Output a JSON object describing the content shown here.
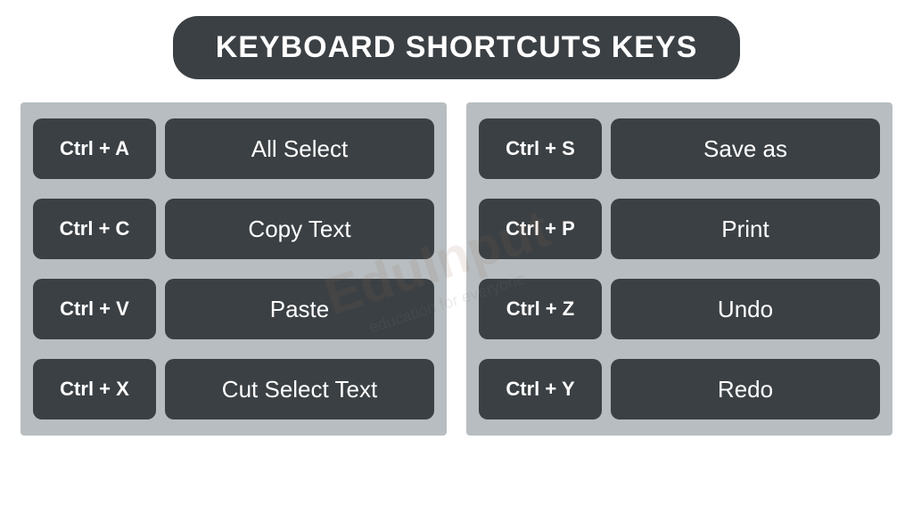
{
  "title": "Keyboard Shortcuts Keys",
  "columns": [
    {
      "rows": [
        {
          "key": "Ctrl + A",
          "desc": "All Select"
        },
        {
          "key": "Ctrl + C",
          "desc": "Copy Text"
        },
        {
          "key": "Ctrl + V",
          "desc": "Paste"
        },
        {
          "key": "Ctrl + X",
          "desc": "Cut Select Text"
        }
      ]
    },
    {
      "rows": [
        {
          "key": "Ctrl + S",
          "desc": "Save as"
        },
        {
          "key": "Ctrl + P",
          "desc": "Print"
        },
        {
          "key": "Ctrl + Z",
          "desc": "Undo"
        },
        {
          "key": "Ctrl + Y",
          "desc": "Redo"
        }
      ]
    }
  ],
  "watermark": {
    "main": "EduInput",
    "sub": "education for everyone"
  }
}
